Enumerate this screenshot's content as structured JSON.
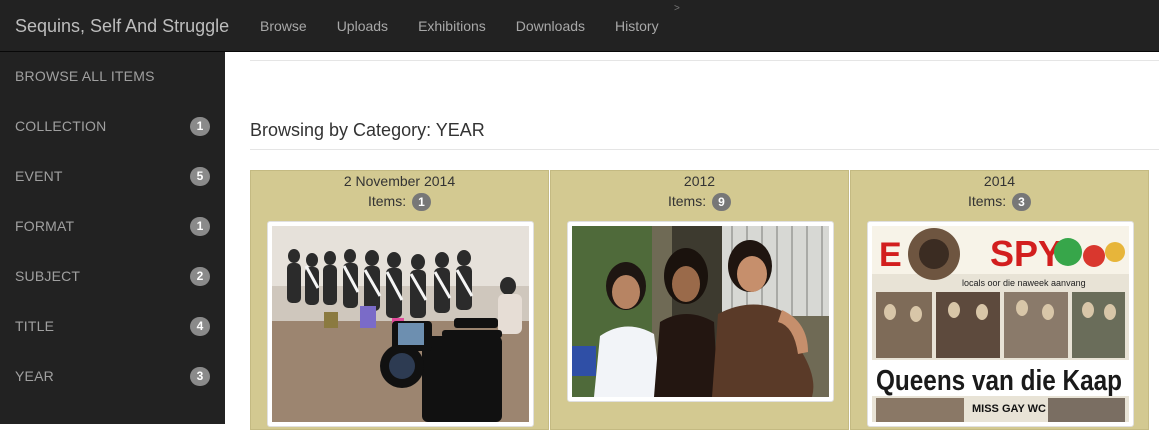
{
  "app": {
    "brand": "Sequins, Self And Struggle",
    "nav": [
      "Browse",
      "Uploads",
      "Exhibitions",
      "Downloads",
      "History"
    ],
    "caret": ">"
  },
  "sidebar": {
    "items": [
      {
        "label": "BROWSE ALL ITEMS",
        "count": ""
      },
      {
        "label": "COLLECTION",
        "count": "1"
      },
      {
        "label": "EVENT",
        "count": "5"
      },
      {
        "label": "FORMAT",
        "count": "1"
      },
      {
        "label": "SUBJECT",
        "count": "2"
      },
      {
        "label": "TITLE",
        "count": "4"
      },
      {
        "label": "YEAR",
        "count": "3"
      }
    ]
  },
  "main": {
    "title": "Browsing by Category: YEAR",
    "items_label": "Items:",
    "tiles": [
      {
        "title": "2 November 2014",
        "count": "1",
        "image": "photo-of-pageant-contestants-seated-with-video-camera"
      },
      {
        "title": "2012",
        "count": "9",
        "image": "photo-of-three-women-posing"
      },
      {
        "title": "2014",
        "count": "3",
        "image": "newspaper-clipping"
      }
    ],
    "newspaper": {
      "masthead": "SPY",
      "subhead": "locals oor die naweek aanvang",
      "headline": "Queens van die Kaap",
      "caption": "MISS GAY WC"
    }
  },
  "colors": {
    "navbar": "#222222",
    "tile": "#d3c991",
    "badge": "#8a8a8a"
  }
}
